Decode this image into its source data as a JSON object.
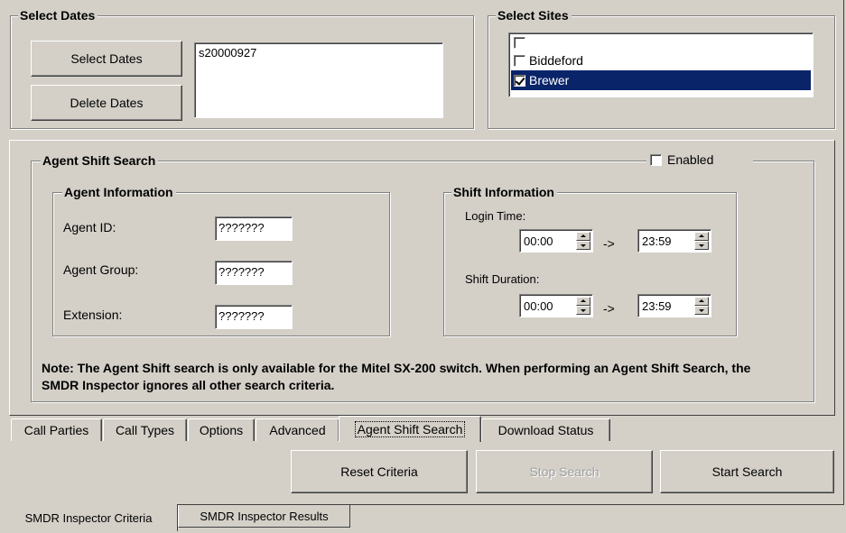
{
  "select_dates": {
    "legend": "Select Dates",
    "select_button": "Select Dates",
    "delete_button": "Delete Dates",
    "dates": [
      "s20000927"
    ]
  },
  "select_sites": {
    "legend": "Select Sites",
    "items": [
      {
        "label": "",
        "checked": false,
        "selected": false
      },
      {
        "label": "Biddeford",
        "checked": false,
        "selected": false
      },
      {
        "label": "Brewer",
        "checked": true,
        "selected": true
      }
    ]
  },
  "agent_shift": {
    "legend": "Agent Shift Search",
    "enabled_label": "Enabled",
    "enabled": false,
    "agent_info": {
      "legend": "Agent Information",
      "agent_id_label": "Agent ID:",
      "agent_id": "???????",
      "agent_group_label": "Agent Group:",
      "agent_group": "???????",
      "extension_label": "Extension:",
      "extension": "???????"
    },
    "shift_info": {
      "legend": "Shift Information",
      "login_time_label": "Login Time:",
      "login_from": "00:00",
      "login_to": "23:59",
      "arrow": "->",
      "duration_label": "Shift Duration:",
      "duration_from": "00:00",
      "duration_to": "23:59"
    },
    "note": "Note: The Agent Shift search is only available for the Mitel SX-200 switch. When performing an Agent Shift Search, the SMDR Inspector ignores all other search criteria."
  },
  "tabs": [
    "Call Parties",
    "Call Types",
    "Options",
    "Advanced",
    "Agent Shift Search",
    "Download Status"
  ],
  "active_tab": "Agent Shift Search",
  "actions": {
    "reset": "Reset Criteria",
    "stop": "Stop Search",
    "start": "Start Search"
  },
  "bottom_tabs": [
    "SMDR Inspector Criteria",
    "SMDR Inspector Results"
  ],
  "colors": {
    "face": "#d4d0c8",
    "selection": "#0a246a"
  }
}
